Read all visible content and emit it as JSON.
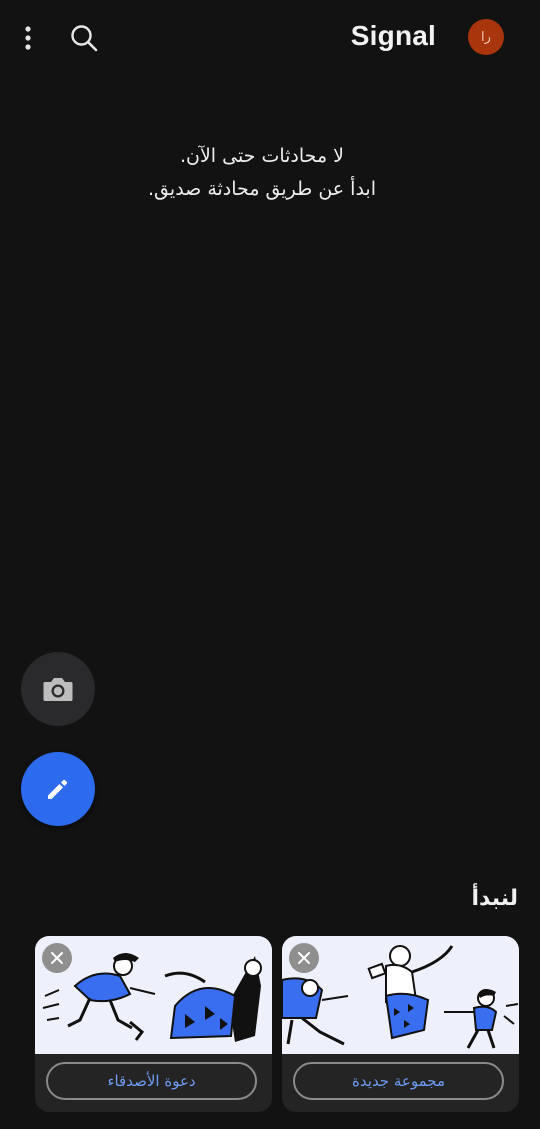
{
  "header": {
    "title": "Signal",
    "avatar_initials": "را",
    "avatar_color": "#a8350c",
    "icons": [
      "more-vertical-icon",
      "search-icon"
    ]
  },
  "empty_state": {
    "line1": "لا محادثات حتى الآن.",
    "line2": "ابدأ عن طريق محادثة صديق."
  },
  "fabs": {
    "camera_icon": "camera-icon",
    "compose_icon": "pencil-icon",
    "compose_color": "#2c6bed"
  },
  "getting_started": {
    "title": "لنبدأ",
    "cards": [
      {
        "button_label": "دعوة الأصدقاء",
        "icon": "close-icon"
      },
      {
        "button_label": "مجموعة جديدة",
        "icon": "close-icon"
      }
    ]
  }
}
